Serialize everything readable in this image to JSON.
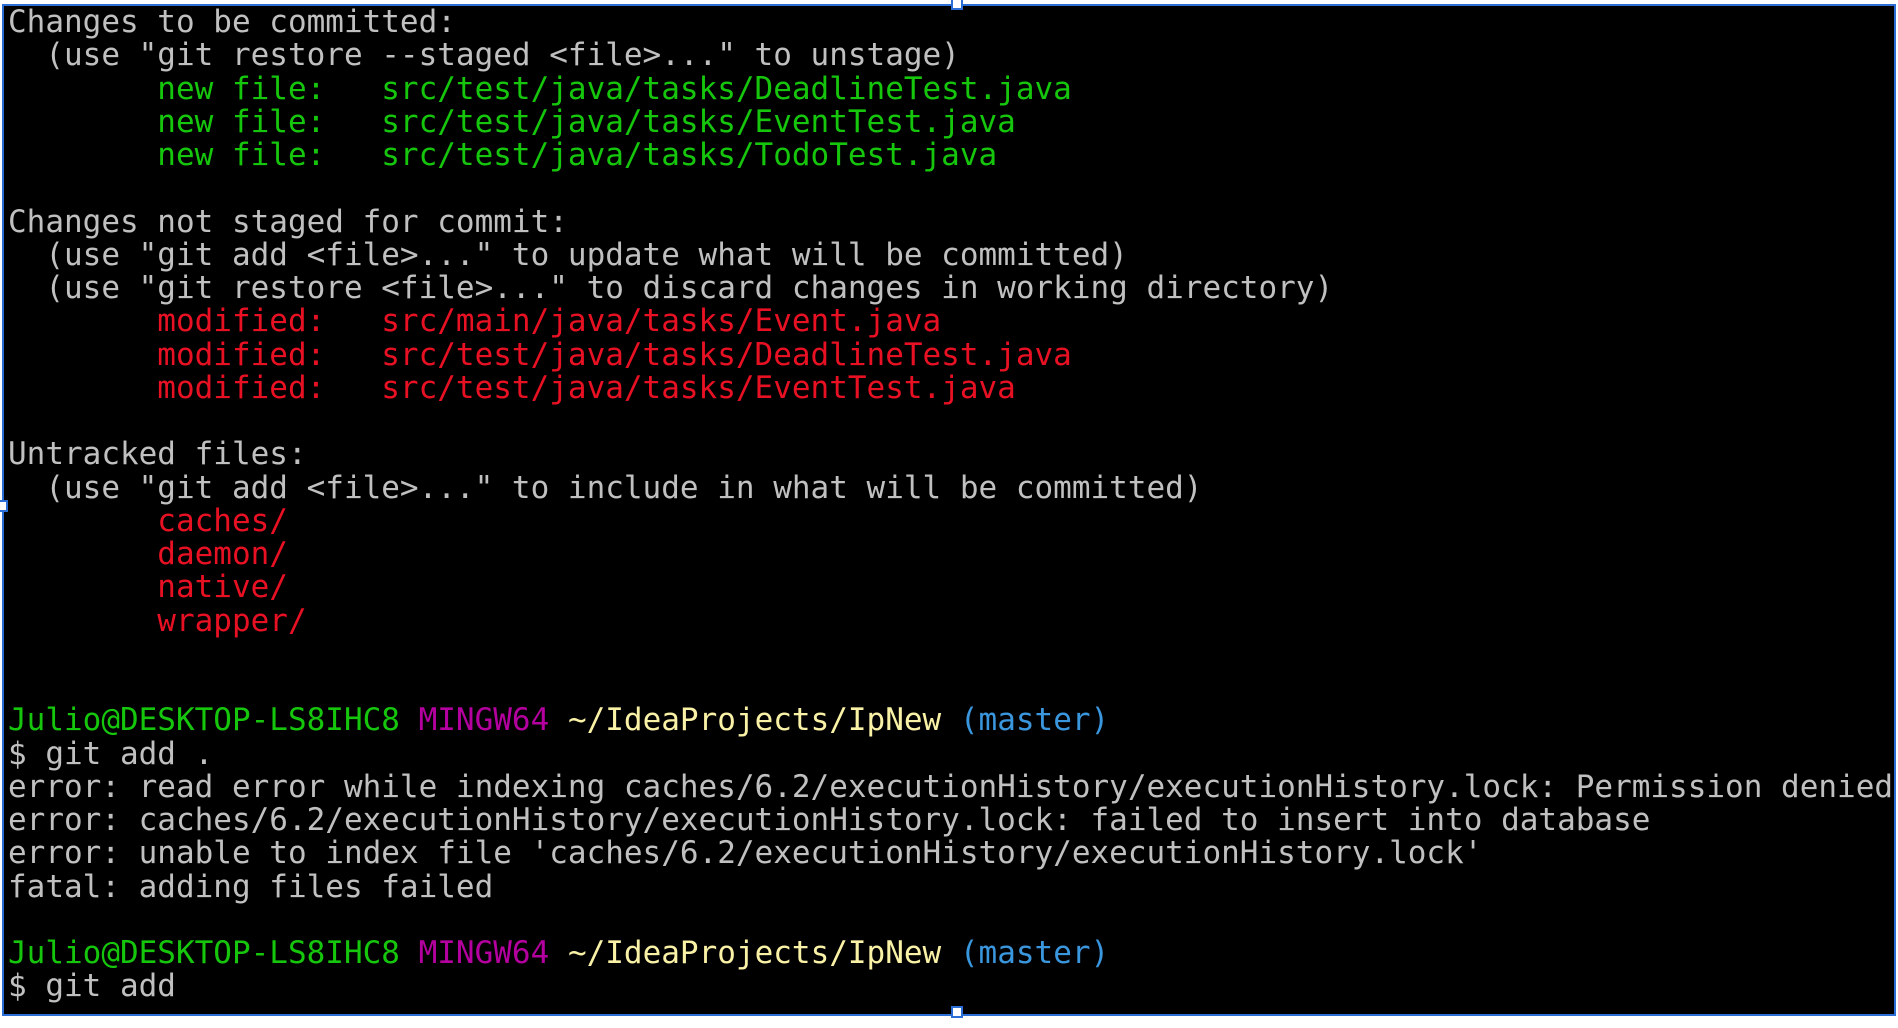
{
  "colors": {
    "default": "#c0c0c0",
    "staged": "#16c60c",
    "unstaged": "#e81123",
    "user": "#16c60c",
    "shell": "#b4009e",
    "path": "#f9f1a5",
    "branch": "#3a96dd"
  },
  "lines": [
    [
      {
        "text": "Changes to be committed:",
        "color": "default"
      }
    ],
    [
      {
        "text": "  (use \"git restore --staged <file>...\" to unstage)",
        "color": "default"
      }
    ],
    [
      {
        "text": "        new file:   src/test/java/tasks/DeadlineTest.java",
        "color": "staged"
      }
    ],
    [
      {
        "text": "        new file:   src/test/java/tasks/EventTest.java",
        "color": "staged"
      }
    ],
    [
      {
        "text": "        new file:   src/test/java/tasks/TodoTest.java",
        "color": "staged"
      }
    ],
    [
      {
        "text": "",
        "color": "default"
      }
    ],
    [
      {
        "text": "Changes not staged for commit:",
        "color": "default"
      }
    ],
    [
      {
        "text": "  (use \"git add <file>...\" to update what will be committed)",
        "color": "default"
      }
    ],
    [
      {
        "text": "  (use \"git restore <file>...\" to discard changes in working directory)",
        "color": "default"
      }
    ],
    [
      {
        "text": "        modified:   src/main/java/tasks/Event.java",
        "color": "unstaged"
      }
    ],
    [
      {
        "text": "        modified:   src/test/java/tasks/DeadlineTest.java",
        "color": "unstaged"
      }
    ],
    [
      {
        "text": "        modified:   src/test/java/tasks/EventTest.java",
        "color": "unstaged"
      }
    ],
    [
      {
        "text": "",
        "color": "default"
      }
    ],
    [
      {
        "text": "Untracked files:",
        "color": "default"
      }
    ],
    [
      {
        "text": "  (use \"git add <file>...\" to include in what will be committed)",
        "color": "default"
      }
    ],
    [
      {
        "text": "        caches/",
        "color": "unstaged"
      }
    ],
    [
      {
        "text": "        daemon/",
        "color": "unstaged"
      }
    ],
    [
      {
        "text": "        native/",
        "color": "unstaged"
      }
    ],
    [
      {
        "text": "        wrapper/",
        "color": "unstaged"
      }
    ],
    [
      {
        "text": "",
        "color": "default"
      }
    ],
    [
      {
        "text": "",
        "color": "default"
      }
    ],
    [
      {
        "text": "Julio@DESKTOP-LS8IHC8",
        "color": "user"
      },
      {
        "text": " ",
        "color": "default"
      },
      {
        "text": "MINGW64",
        "color": "shell"
      },
      {
        "text": " ",
        "color": "default"
      },
      {
        "text": "~/IdeaProjects/IpNew",
        "color": "path"
      },
      {
        "text": " ",
        "color": "default"
      },
      {
        "text": "(master)",
        "color": "branch"
      }
    ],
    [
      {
        "text": "$ git add .",
        "color": "default"
      }
    ],
    [
      {
        "text": "error: read error while indexing caches/6.2/executionHistory/executionHistory.lock: Permission denied",
        "color": "default"
      }
    ],
    [
      {
        "text": "error: caches/6.2/executionHistory/executionHistory.lock: failed to insert into database",
        "color": "default"
      }
    ],
    [
      {
        "text": "error: unable to index file 'caches/6.2/executionHistory/executionHistory.lock'",
        "color": "default"
      }
    ],
    [
      {
        "text": "fatal: adding files failed",
        "color": "default"
      }
    ],
    [
      {
        "text": "",
        "color": "default"
      }
    ],
    [
      {
        "text": "Julio@DESKTOP-LS8IHC8",
        "color": "user"
      },
      {
        "text": " ",
        "color": "default"
      },
      {
        "text": "MINGW64",
        "color": "shell"
      },
      {
        "text": " ",
        "color": "default"
      },
      {
        "text": "~/IdeaProjects/IpNew",
        "color": "path"
      },
      {
        "text": " ",
        "color": "default"
      },
      {
        "text": "(master)",
        "color": "branch"
      }
    ],
    [
      {
        "text": "$ git add",
        "color": "default"
      }
    ]
  ]
}
